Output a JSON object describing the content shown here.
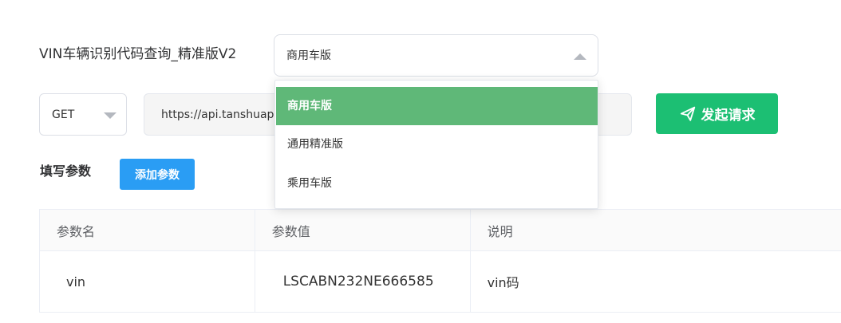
{
  "api": {
    "title": "VIN车辆识别代码查询_精准版V2",
    "version_selected": "商用车版",
    "version_options": [
      "商用车版",
      "通用精准版",
      "乘用车版"
    ]
  },
  "request": {
    "method": "GET",
    "url": "https://api.tanshuap",
    "send_label": "发起请求"
  },
  "params": {
    "label": "填写参数",
    "add_label": "添加参数",
    "headers": [
      "参数名",
      "参数值",
      "说明"
    ],
    "rows": [
      {
        "name": "vin",
        "value": "LSCABN232NE666585",
        "desc": "vin码"
      }
    ]
  },
  "colors": {
    "send_button": "#1cbf73",
    "add_button": "#2a9df4",
    "selected_option": "#5fb878"
  },
  "icons": {
    "send": "paper-plane-icon",
    "version_caret": "caret-up-icon",
    "method_caret": "caret-down-icon"
  }
}
